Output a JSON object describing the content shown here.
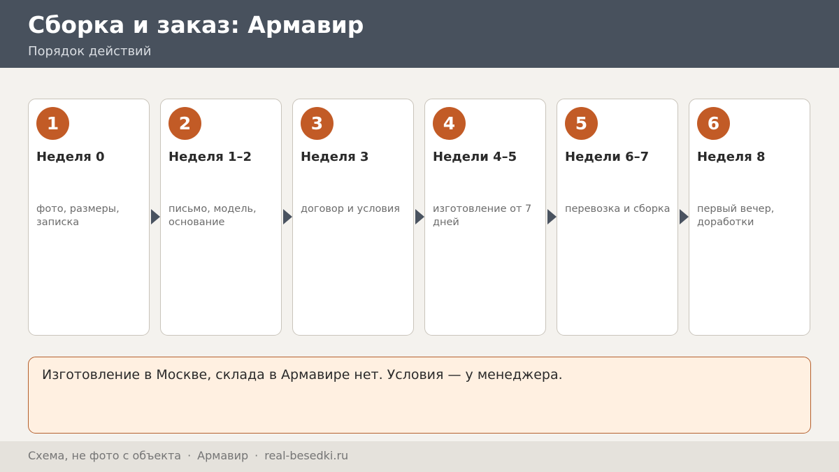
{
  "header": {
    "title": "Сборка и заказ: Армавир",
    "subtitle": "Порядок действий"
  },
  "steps": [
    {
      "number": "1",
      "title": "Неделя 0",
      "description": "фото, размеры, записка"
    },
    {
      "number": "2",
      "title": "Неделя 1–2",
      "description": "письмо, модель, основание"
    },
    {
      "number": "3",
      "title": "Неделя 3",
      "description": "договор и условия"
    },
    {
      "number": "4",
      "title": "Недели 4–5",
      "description": "изготовление от 7 дней"
    },
    {
      "number": "5",
      "title": "Недели 6–7",
      "description": "перевозка и сборка"
    },
    {
      "number": "6",
      "title": "Неделя 8",
      "description": "первый вечер, доработки"
    }
  ],
  "note": {
    "text": "Изготовление в Москве, склада в Армавире нет. Условия — у менеджера."
  },
  "footer": {
    "part1": "Схема, не фото с объекта",
    "separator": "·",
    "part2": "Армавир",
    "part3": "real-besedki.ru"
  },
  "colors": {
    "header_bg": "#48515d",
    "accent": "#c25b26",
    "note_bg": "#fff0e1",
    "note_border": "#b4602e",
    "page_bg": "#f4f2ee"
  }
}
